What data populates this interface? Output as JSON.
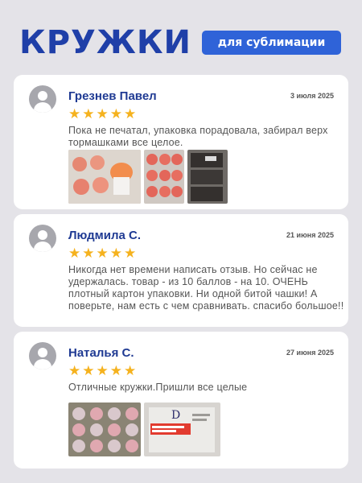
{
  "header": {
    "title": "КРУЖКИ",
    "badge": "для сублимации"
  },
  "reviews": [
    {
      "name": "Грезнев Павел",
      "date": "3 июля 2025",
      "rating": 5,
      "text": "Пока не печатал, упаковка порадовала, забирал верх тормашками все целое."
    },
    {
      "name": "Людмила С.",
      "date": "21 июня 2025",
      "rating": 5,
      "text": "Никогда нет времени написать отзыв. Но сейчас не удержалась. товар - из 10 баллов - на 10. ОЧЕНЬ плотный картон упаковки. Ни одной битой чашки! А поверьте, нам есть с чем сравнивать. спасибо большое!!"
    },
    {
      "name": "Наталья С.",
      "date": "27 июня 2025",
      "rating": 5,
      "text": "Отличные кружки.Пришли все целые"
    }
  ],
  "icons": {
    "avatar": "user-avatar-icon",
    "star": "star-icon"
  },
  "colors": {
    "background": "#e4e3e8",
    "title": "#1f3fa8",
    "badge": "#2f63d8",
    "name": "#1f3a93",
    "star": "#f5b21e"
  }
}
